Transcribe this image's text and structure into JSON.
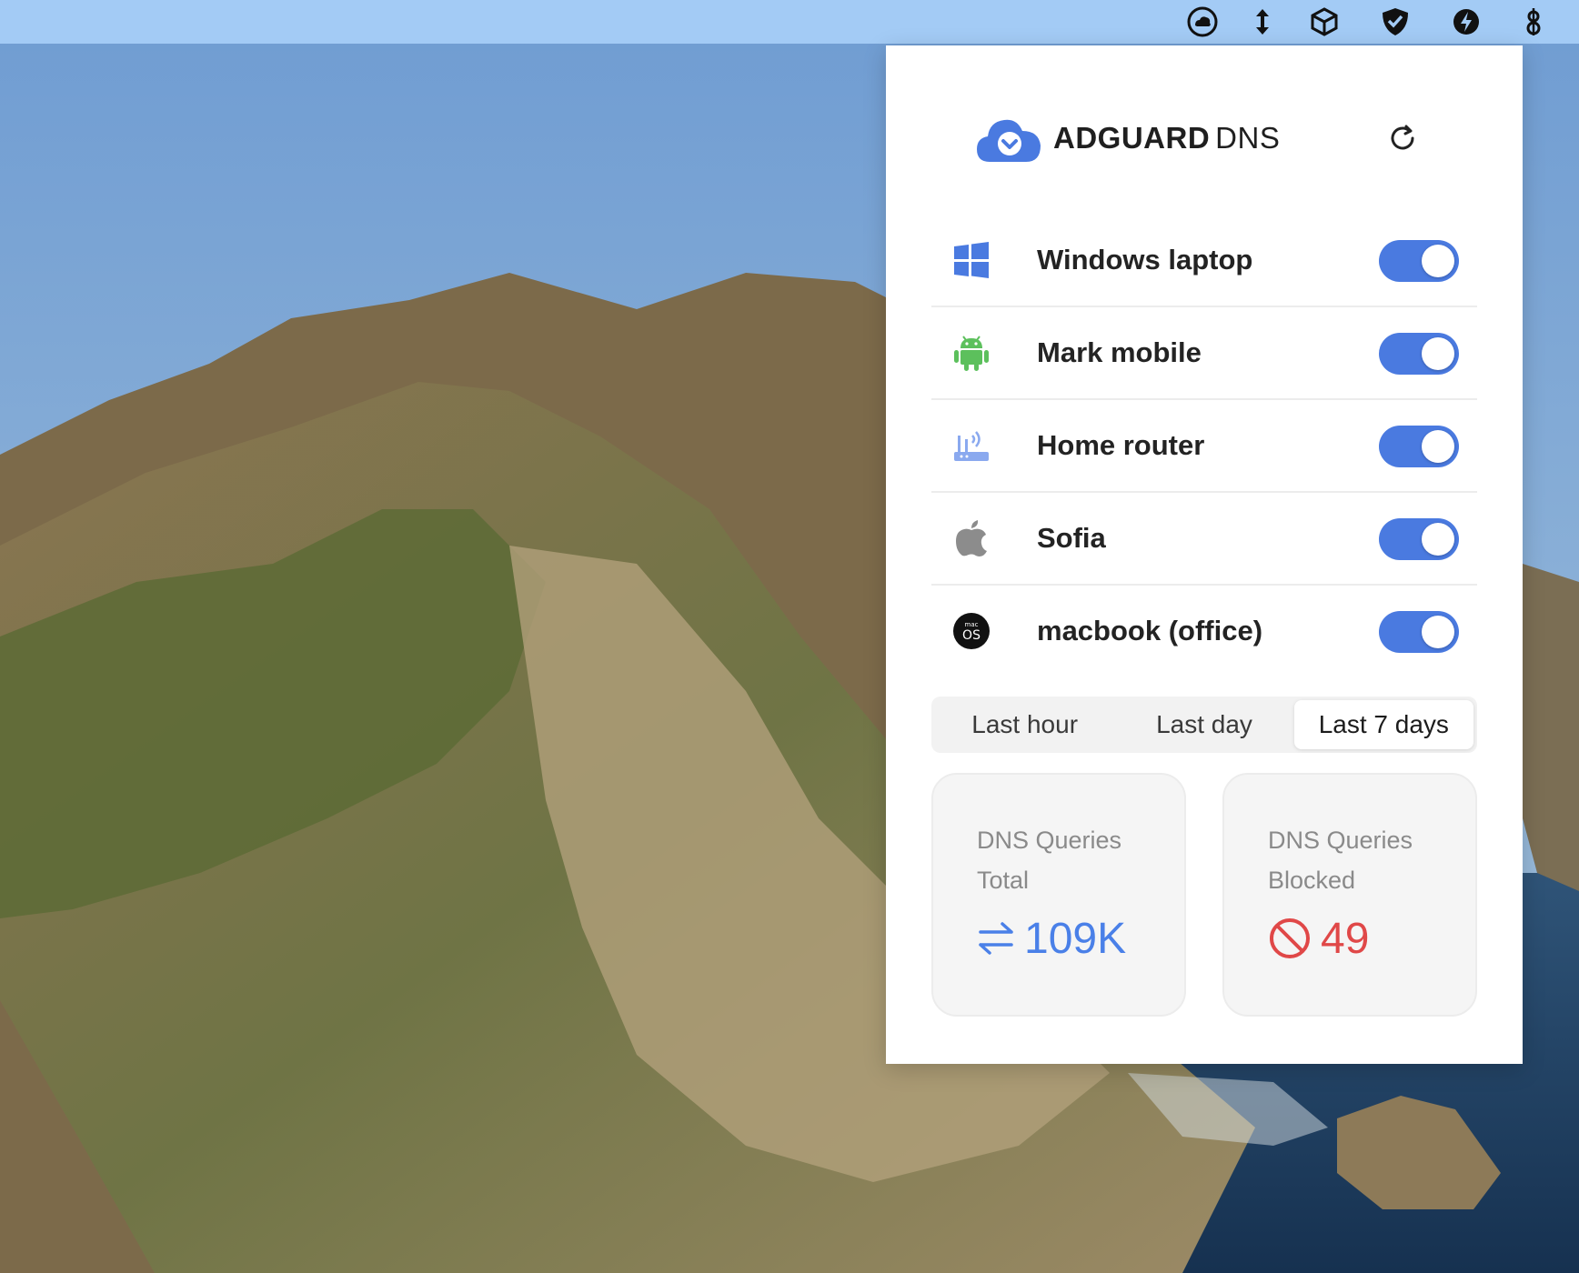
{
  "menubar": {
    "icons": [
      "cloud-status-icon",
      "sort-arrows-icon",
      "box-icon",
      "shield-check-icon",
      "bolt-icon",
      "dollar-script-icon"
    ]
  },
  "panel": {
    "brand_bold": "ADGUARD",
    "brand_light": "DNS",
    "devices": [
      {
        "name": "Windows laptop",
        "icon": "windows-icon",
        "enabled": true
      },
      {
        "name": "Mark mobile",
        "icon": "android-icon",
        "enabled": true
      },
      {
        "name": "Home router",
        "icon": "router-icon",
        "enabled": true
      },
      {
        "name": "Sofia",
        "icon": "apple-icon",
        "enabled": true
      },
      {
        "name": "macbook (office)",
        "icon": "macos-icon",
        "enabled": true
      }
    ],
    "range": {
      "options": [
        "Last hour",
        "Last day",
        "Last 7 days"
      ],
      "selected": "Last 7 days"
    },
    "stats": {
      "total_label_1": "DNS Queries",
      "total_label_2": "Total",
      "total_value": "109K",
      "blocked_label_1": "DNS Queries",
      "blocked_label_2": "Blocked",
      "blocked_value": "49"
    }
  },
  "colors": {
    "accent": "#4a7ae0",
    "total": "#4a80e8",
    "blocked": "#e04848",
    "android": "#5cc05c",
    "windows": "#4a7ae0"
  }
}
